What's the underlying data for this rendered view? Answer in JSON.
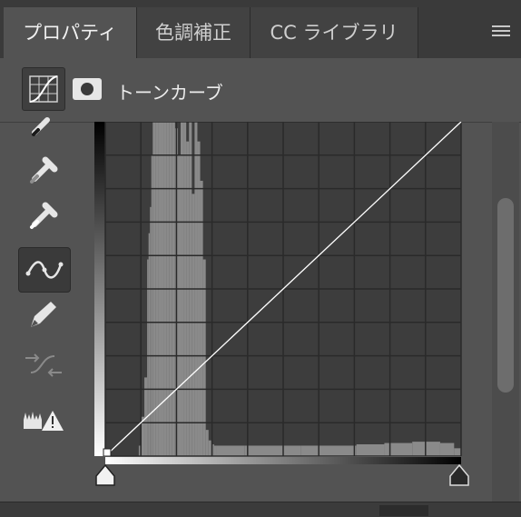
{
  "tabs": [
    {
      "label": "プロパティ",
      "active": true
    },
    {
      "label": "色調補正",
      "active": false
    },
    {
      "label": "CC ライブラリ",
      "active": false
    }
  ],
  "panel": {
    "title": "トーンカーブ",
    "icons": [
      "curves-adjustment-icon",
      "layer-mask-icon",
      "panel-menu-icon"
    ]
  },
  "tools": [
    "eyedropper-black-point-icon",
    "eyedropper-gray-point-icon",
    "eyedropper-white-point-icon",
    "curve-point-edit-icon",
    "pencil-draw-icon",
    "smooth-curve-icon",
    "clipping-warning-icon"
  ],
  "colors": {
    "panel_bg": "#535353",
    "tabbar_bg": "#3a3a3a",
    "graph_bg": "#3d3d3d",
    "histogram": "#8a8a8a",
    "curve": "#ffffff"
  },
  "chart_data": {
    "type": "area",
    "title": "",
    "xlabel": "",
    "ylabel": "",
    "xlim": [
      0,
      255
    ],
    "ylim": [
      0,
      255
    ],
    "grid": "4x4 with finer sub-grid",
    "curve_points": [
      [
        0,
        0
      ],
      [
        255,
        255
      ]
    ],
    "histogram": {
      "x": [
        0,
        20,
        24,
        26,
        28,
        30,
        31,
        32,
        33,
        34,
        36,
        38,
        40,
        42,
        44,
        46,
        48,
        50,
        52,
        54,
        56,
        58,
        60,
        62,
        64,
        66,
        68,
        70,
        72,
        74,
        76,
        78,
        80,
        100,
        140,
        180,
        200,
        220,
        240,
        250,
        255
      ],
      "values": [
        0,
        0,
        8,
        30,
        60,
        150,
        170,
        190,
        230,
        255,
        255,
        255,
        255,
        255,
        255,
        255,
        255,
        250,
        230,
        255,
        255,
        240,
        255,
        200,
        255,
        240,
        210,
        150,
        20,
        12,
        9,
        8,
        8,
        8,
        8,
        9,
        10,
        11,
        10,
        6,
        0
      ],
      "ylim": [
        0,
        255
      ]
    }
  }
}
